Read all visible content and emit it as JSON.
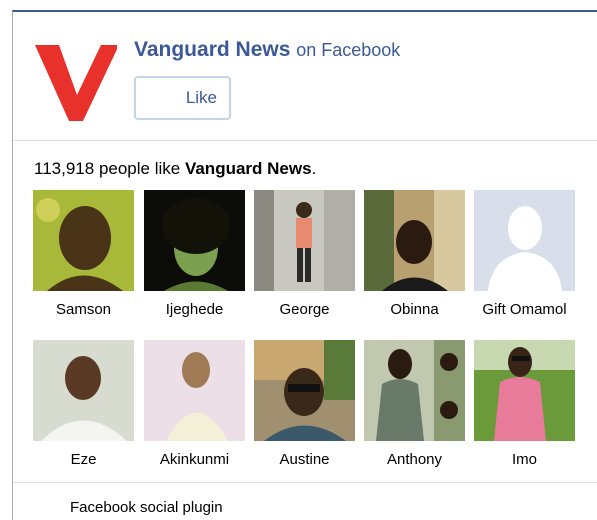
{
  "header": {
    "page_name": "Vanguard News",
    "on_text": "on Facebook",
    "like_label": "Like",
    "brand_color": "#3b5998",
    "logo_color": "#e8312a"
  },
  "summary": {
    "count": "113,918",
    "middle": "people like",
    "page_name": "Vanguard News",
    "end": "."
  },
  "fans": [
    {
      "name": "Samson"
    },
    {
      "name": "Ijeghede"
    },
    {
      "name": "George"
    },
    {
      "name": "Obinna"
    },
    {
      "name": "Gift Omamol"
    },
    {
      "name": "Eze"
    },
    {
      "name": "Akinkunmi"
    },
    {
      "name": "Austine"
    },
    {
      "name": "Anthony"
    },
    {
      "name": "Imo"
    }
  ],
  "footer": {
    "label": "Facebook social plugin"
  }
}
